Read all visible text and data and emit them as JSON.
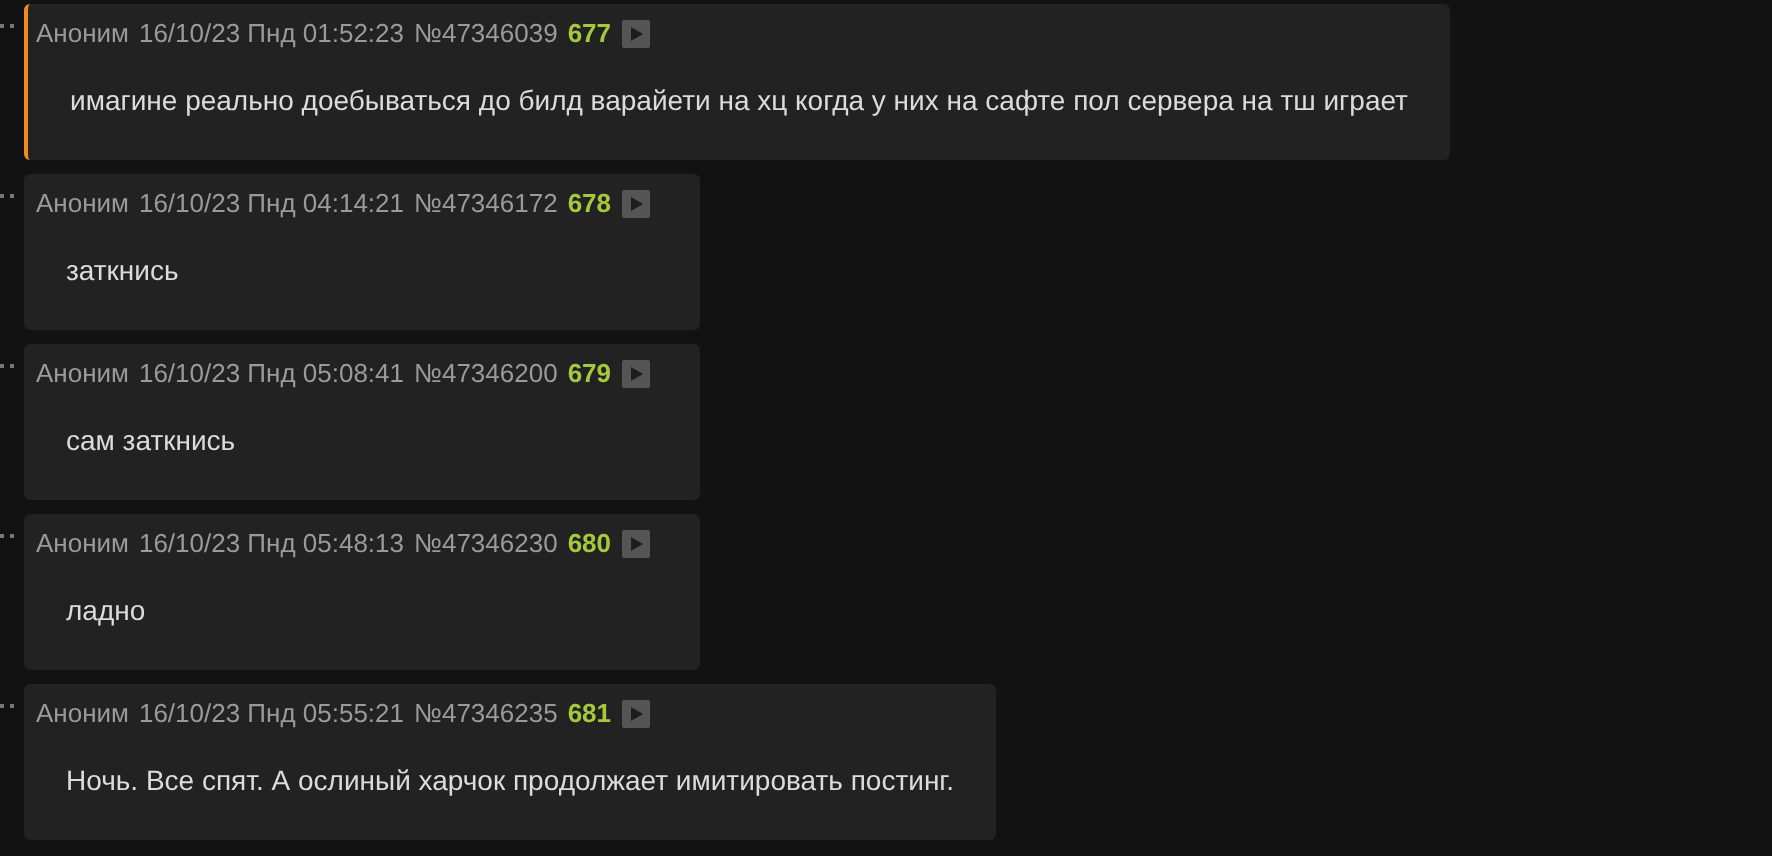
{
  "posts": [
    {
      "name": "Аноним",
      "date": "16/10/23 Пнд 01:52:23",
      "number": "№47346039",
      "index": "677",
      "highlighted": true,
      "text": "имагине реально доебываться до билд варайети на хц когда у них на сафте пол сервера на тш играет"
    },
    {
      "name": "Аноним",
      "date": "16/10/23 Пнд 04:14:21",
      "number": "№47346172",
      "index": "678",
      "highlighted": false,
      "text": "заткнись"
    },
    {
      "name": "Аноним",
      "date": "16/10/23 Пнд 05:08:41",
      "number": "№47346200",
      "index": "679",
      "highlighted": false,
      "text": "сам заткнись"
    },
    {
      "name": "Аноним",
      "date": "16/10/23 Пнд 05:48:13",
      "number": "№47346230",
      "index": "680",
      "highlighted": false,
      "text": "ладно"
    },
    {
      "name": "Аноним",
      "date": "16/10/23 Пнд 05:55:21",
      "number": "№47346235",
      "index": "681",
      "highlighted": false,
      "text": "Ночь. Все спят. А ослиный харчок продолжает имитировать постинг."
    }
  ]
}
